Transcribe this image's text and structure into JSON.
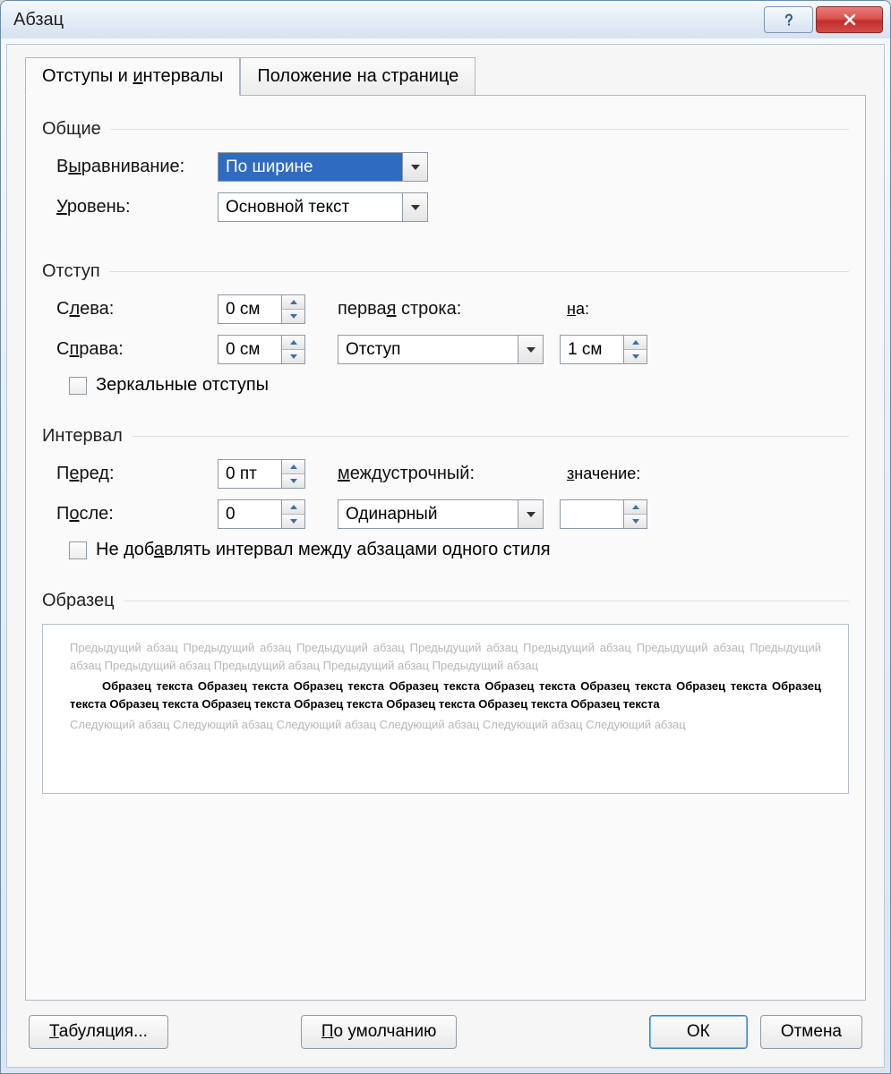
{
  "window": {
    "title": "Абзац"
  },
  "tabs": {
    "active": "Отступы и интервалы",
    "inactive": "Положение на странице"
  },
  "general": {
    "section": "Общие",
    "alignment_label": "Выравнивание:",
    "alignment_value": "По ширине",
    "level_label": "Уровень:",
    "level_value": "Основной текст"
  },
  "indent": {
    "section": "Отступ",
    "left_label": "Слева:",
    "left_value": "0 см",
    "right_label": "Справа:",
    "right_value": "0 см",
    "firstline_label": "первая строка:",
    "firstline_value": "Отступ",
    "by_label": "на:",
    "by_value": "1 см",
    "mirror_label": "Зеркальные отступы",
    "mirror_checked": false
  },
  "spacing": {
    "section": "Интервал",
    "before_label": "Перед:",
    "before_value": "0 пт",
    "after_label": "После:",
    "after_value": "0",
    "linespacing_label": "междустрочный:",
    "linespacing_value": "Одинарный",
    "at_label": "значение:",
    "at_value": "",
    "nosame_label": "Не добавлять интервал между абзацами одного стиля",
    "nosame_checked": false
  },
  "preview": {
    "section": "Образец",
    "prev_text": "Предыдущий абзац Предыдущий абзац Предыдущий абзац Предыдущий абзац Предыдущий абзац Предыдущий абзац Предыдущий абзац Предыдущий абзац Предыдущий абзац Предыдущий абзац Предыдущий абзац",
    "sample_text": "Образец текста Образец текста Образец текста Образец текста Образец текста Образец текста Образец текста Образец текста Образец текста Образец текста Образец текста Образец текста Образец текста Образец текста",
    "next_text": "Следующий абзац Следующий абзац Следующий абзац Следующий абзац Следующий абзац Следующий абзац"
  },
  "buttons": {
    "tabs": "Табуляция...",
    "default": "По умолчанию",
    "ok": "ОК",
    "cancel": "Отмена"
  }
}
